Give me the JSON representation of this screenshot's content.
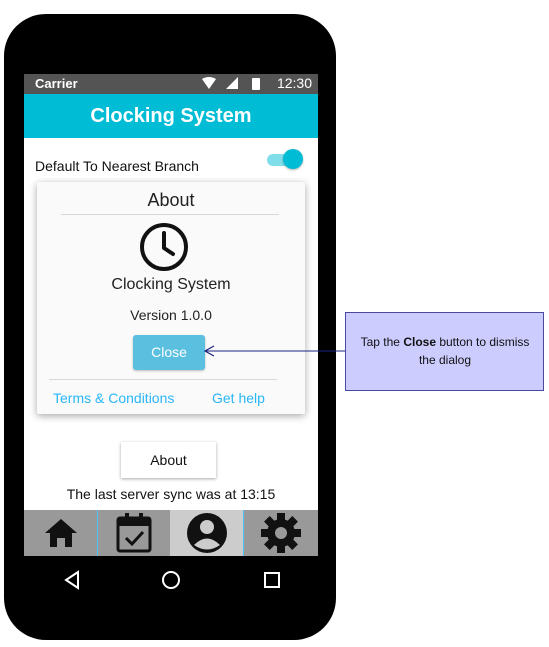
{
  "status": {
    "carrier": "Carrier",
    "time": "12:30"
  },
  "app": {
    "title": "Clocking System"
  },
  "settings": {
    "default_branch_label": "Default To Nearest Branch",
    "default_branch_on": true
  },
  "dialog": {
    "title": "About",
    "app_name": "Clocking System",
    "version": "Version 1.0.0",
    "close_label": "Close",
    "terms_label": "Terms & Conditions",
    "help_label": "Get help"
  },
  "main": {
    "about_label": "About",
    "sync_text": "The last server sync was at 13:15"
  },
  "tabs": [
    {
      "name": "home-icon"
    },
    {
      "name": "calendar-check-icon"
    },
    {
      "name": "profile-icon",
      "active": true
    },
    {
      "name": "gear-icon"
    }
  ],
  "nav": [
    "back-icon",
    "home-circle-icon",
    "recents-icon"
  ],
  "callout": {
    "pre": "Tap the ",
    "bold": "Close",
    "post": " button to dismiss the dialog"
  },
  "colors": {
    "accent": "#00bcd4",
    "close_button": "#5bbfe0",
    "link": "#29b6f6",
    "callout_bg": "#ccccff"
  }
}
